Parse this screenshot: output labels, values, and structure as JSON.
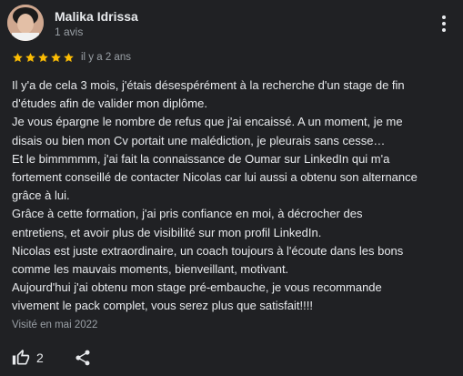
{
  "review": {
    "author": "Malika Idrissa",
    "review_count": "1 avis",
    "rating": 5,
    "rating_max": 5,
    "date": "il y a 2 ans",
    "star_color": "#fbbc04",
    "lines": [
      "Il y'a de cela 3 mois, j'étais désespérément à la recherche d'un stage de fin",
      "d'études afin de valider mon diplôme.",
      "Je vous épargne le nombre de refus que j'ai encaissé. A un moment, je me",
      "disais ou bien mon Cv portait une malédiction, je pleurais sans cesse…",
      "Et le bimmmmm, j'ai fait la connaissance de Oumar sur LinkedIn qui m'a",
      "fortement conseillé de contacter Nicolas car lui aussi a obtenu son alternance",
      "grâce à lui.",
      "Grâce à cette formation, j'ai pris confiance en moi, à décrocher des",
      "entretiens, et avoir plus de visibilité sur mon profil LinkedIn.",
      "Nicolas est juste extraordinaire, un coach toujours à l'écoute dans les bons",
      "comme les mauvais moments, bienveillant, motivant.",
      "Aujourd'hui j'ai obtenu mon stage pré-embauche, je vous recommande",
      "vivement le pack complet, vous serez plus que satisfait!!!!"
    ],
    "visited": "Visité en mai 2022",
    "like_count": "2"
  },
  "icons": {
    "avatar": "avatar-photo",
    "more": "more-vert-icon",
    "star": "star-icon",
    "like": "thumb-up-icon",
    "share": "share-icon"
  },
  "colors": {
    "background": "#202124",
    "text": "#e8eaed",
    "secondary_text": "#9aa0a6"
  }
}
